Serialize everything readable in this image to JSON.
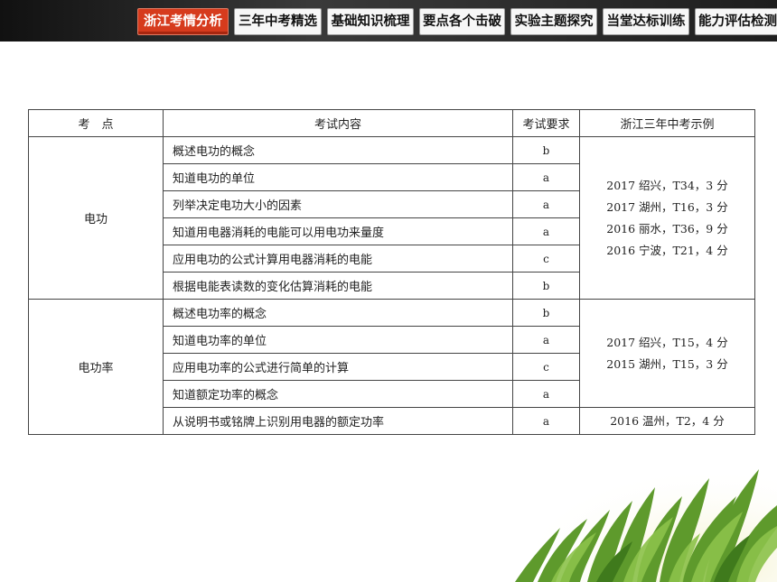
{
  "nav": {
    "tabs": [
      {
        "label": "浙江考情分析",
        "active": true
      },
      {
        "label": "三年中考精选",
        "active": false
      },
      {
        "label": "基础知识梳理",
        "active": false
      },
      {
        "label": "要点各个击破",
        "active": false
      },
      {
        "label": "实验主题探究",
        "active": false
      },
      {
        "label": "当堂达标训练",
        "active": false
      },
      {
        "label": "能力评估检测",
        "active": false
      }
    ],
    "active_color": "#d63b1d"
  },
  "table": {
    "headers": [
      "考　点",
      "考试内容",
      "考试要求",
      "浙江三年中考示例"
    ],
    "groups": [
      {
        "topic": "电功",
        "rows": [
          {
            "content": "概述电功的概念",
            "req": "b"
          },
          {
            "content": "知道电功的单位",
            "req": "a"
          },
          {
            "content": "列举决定电功大小的因素",
            "req": "a"
          },
          {
            "content": "知道用电器消耗的电能可以用电功来量度",
            "req": "a"
          },
          {
            "content": "应用电功的公式计算用电器消耗的电能",
            "req": "c"
          },
          {
            "content": "根据电能表读数的变化估算消耗的电能",
            "req": "b"
          }
        ],
        "examples": [
          "2017 绍兴，T34，3 分",
          "2017 湖州，T16，3 分",
          "2016 丽水，T36，9 分",
          "2016 宁波，T21，4 分"
        ]
      },
      {
        "topic": "电功率",
        "rows": [
          {
            "content": "概述电功率的概念",
            "req": "b"
          },
          {
            "content": "知道电功率的单位",
            "req": "a"
          },
          {
            "content": "应用电功率的公式进行简单的计算",
            "req": "c"
          },
          {
            "content": "知道额定功率的概念",
            "req": "a"
          },
          {
            "content": "从说明书或铭牌上识别用电器的额定功率",
            "req": "a"
          }
        ],
        "examples": [
          "2017 绍兴，T15，4 分",
          "2015 湖州，T15，3 分"
        ],
        "last_example": "2016 温州，T2，4 分"
      }
    ]
  }
}
